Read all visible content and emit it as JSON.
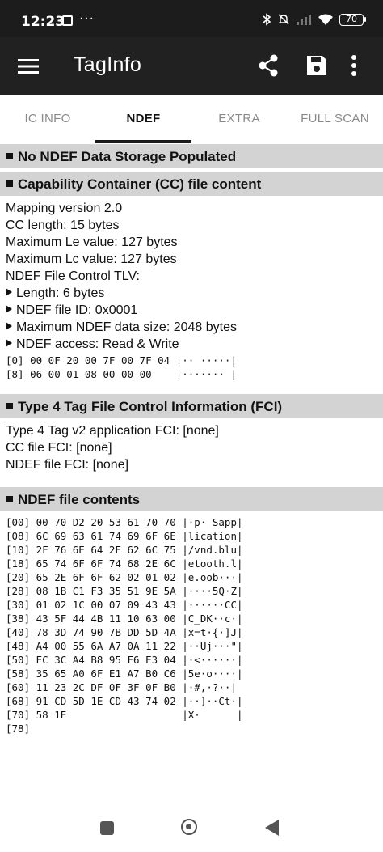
{
  "status_bar": {
    "time": "12:23",
    "more": "···",
    "battery": "70"
  },
  "app_bar": {
    "title": "TagInfo"
  },
  "tabs": [
    "IC INFO",
    "NDEF",
    "EXTRA",
    "FULL SCAN"
  ],
  "sections": {
    "no_ndef": {
      "header": "No NDEF Data Storage Populated"
    },
    "cc": {
      "header": "Capability Container (CC) file content",
      "lines": [
        "Mapping version 2.0",
        "CC length: 15 bytes",
        "Maximum Le value: 127 bytes",
        "Maximum Lc value: 127 bytes",
        "NDEF File Control TLV:"
      ],
      "tlv_items": [
        "Length: 6 bytes",
        "NDEF file ID: 0x0001",
        "Maximum NDEF data size: 2048 bytes",
        "NDEF access: Read & Write"
      ],
      "hex_lines": [
        "[0] 00 0F 20 00 7F 00 7F 04 |·· ·····|",
        "[8] 06 00 01 08 00 00 00    |······· |"
      ]
    },
    "fci": {
      "header": "Type 4 Tag File Control Information (FCI)",
      "lines": [
        "Type 4 Tag v2 application FCI: [none]",
        "CC file FCI: [none]",
        "NDEF file FCI: [none]"
      ]
    },
    "ndef_file": {
      "header": "NDEF file contents",
      "hex_lines": [
        "[00] 00 70 D2 20 53 61 70 70 |·p· Sapp|",
        "[08] 6C 69 63 61 74 69 6F 6E |lication|",
        "[10] 2F 76 6E 64 2E 62 6C 75 |/vnd.blu|",
        "[18] 65 74 6F 6F 74 68 2E 6C |etooth.l|",
        "[20] 65 2E 6F 6F 62 02 01 02 |e.oob···|",
        "[28] 08 1B C1 F3 35 51 9E 5A |····5Q·Z|",
        "[30] 01 02 1C 00 07 09 43 43 |······CC|",
        "[38] 43 5F 44 4B 11 10 63 00 |C_DK··c·|",
        "[40] 78 3D 74 90 7B DD 5D 4A |x=t·{·]J|",
        "[48] A4 00 55 6A A7 0A 11 22 |··Uj···\"|",
        "[50] EC 3C A4 B8 95 F6 E3 04 |·<······|",
        "[58] 35 65 A0 6F E1 A7 B0 C6 |5e·o····|",
        "[60] 11 23 2C DF 0F 3F 0F B0 |·#,·?··|",
        "[68] 91 CD 5D 1E CD 43 74 02 |··]··Ct·|",
        "[70] 58 1E                   |X·      |",
        "[78]"
      ]
    }
  },
  "icons": {
    "menu": "hamburger-menu-icon",
    "share": "share-icon",
    "save": "save-icon",
    "more": "more-vert-icon"
  }
}
